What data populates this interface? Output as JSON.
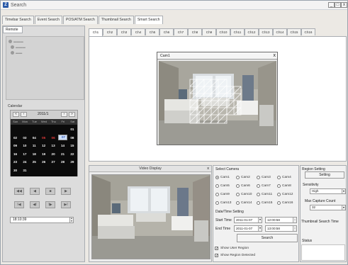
{
  "window": {
    "title": "Search",
    "app_icon": "app-icon",
    "controls": [
      "_",
      "□",
      "x"
    ]
  },
  "top_tabs": [
    "Timebar Search",
    "Event Search",
    "POS/ATM Search",
    "Thumbnail Search",
    "Smart Search"
  ],
  "active_top_tab": "Smart Search",
  "left": {
    "remote_tab": "Remote",
    "tree_icon": "camera-tree-icon",
    "calendar": {
      "label": "Calendar",
      "nav_prev_year": "«",
      "nav_prev": "‹",
      "month": "2011/1",
      "nav_next": "›",
      "nav_next_year": "»",
      "weekdays": [
        "Sun",
        "Mon",
        "Tue",
        "Wed",
        "Thu",
        "Fri",
        "Sat"
      ],
      "weeks": [
        [
          "",
          "",
          "",
          "",
          "",
          "",
          "01"
        ],
        [
          "02",
          "03",
          "04",
          "05",
          "06",
          "07",
          "08"
        ],
        [
          "09",
          "10",
          "11",
          "12",
          "13",
          "14",
          "15"
        ],
        [
          "16",
          "17",
          "18",
          "19",
          "20",
          "21",
          "22"
        ],
        [
          "23",
          "24",
          "25",
          "26",
          "27",
          "28",
          "29"
        ],
        [
          "30",
          "31",
          "",
          "",
          "",
          "",
          ""
        ]
      ],
      "selected_day": "07",
      "red_days": [
        "05",
        "06"
      ]
    },
    "playback": {
      "row1": [
        "◀◀",
        "◀",
        "■",
        "▶"
      ],
      "row2": [
        "I◀",
        "◀I",
        "I▶",
        "▶I"
      ]
    },
    "time_value": "18:10:39"
  },
  "channel_tabs": [
    "Ch1",
    "Ch2",
    "Ch3",
    "Ch4",
    "Ch5",
    "Ch6",
    "Ch7",
    "Ch8",
    "Ch9",
    "Ch10",
    "Ch11",
    "Ch12",
    "Ch13",
    "Ch14",
    "Ch15",
    "Ch16"
  ],
  "active_channel": "Ch1",
  "cam_window": {
    "title": "Cam1",
    "close": "x"
  },
  "video_display": {
    "title": "Video Display",
    "close": "x"
  },
  "select_camera": {
    "label": "Select Camera",
    "cameras": [
      "Cam1",
      "Cam2",
      "Cam3",
      "Cam4",
      "Cam5",
      "Cam6",
      "Cam7",
      "Cam8",
      "Cam9",
      "Cam10",
      "Cam11",
      "Cam12",
      "Cam13",
      "Cam14",
      "Cam15",
      "Cam16"
    ],
    "selected": "Cam1"
  },
  "datetime": {
    "label": "Date/Time Setting",
    "start_label": "Start Time",
    "start_date": "2011-01-07",
    "start_time": "12:00:58",
    "end_label": "End Time",
    "end_date": "2011-01-07",
    "end_time": "13:00:58"
  },
  "search_button": "Search",
  "checkboxes": [
    {
      "label": "Show User Region",
      "checked": true
    },
    {
      "label": "Show Region Detected",
      "checked": true
    }
  ],
  "region": {
    "label": "Region Setting",
    "setting_button": "Setting",
    "sensitivity_label": "Sensitivity",
    "sensitivity_value": "High",
    "max_capture_label": "Max Capture Count",
    "max_capture_value": "32",
    "thumbnail_label": "Thumbnail Search Time",
    "status_label": "Status"
  },
  "colors": {
    "calendar_bg": "#0b0b0b",
    "selected_day": "#cfe1ff",
    "red_day": "#e43a3a"
  }
}
